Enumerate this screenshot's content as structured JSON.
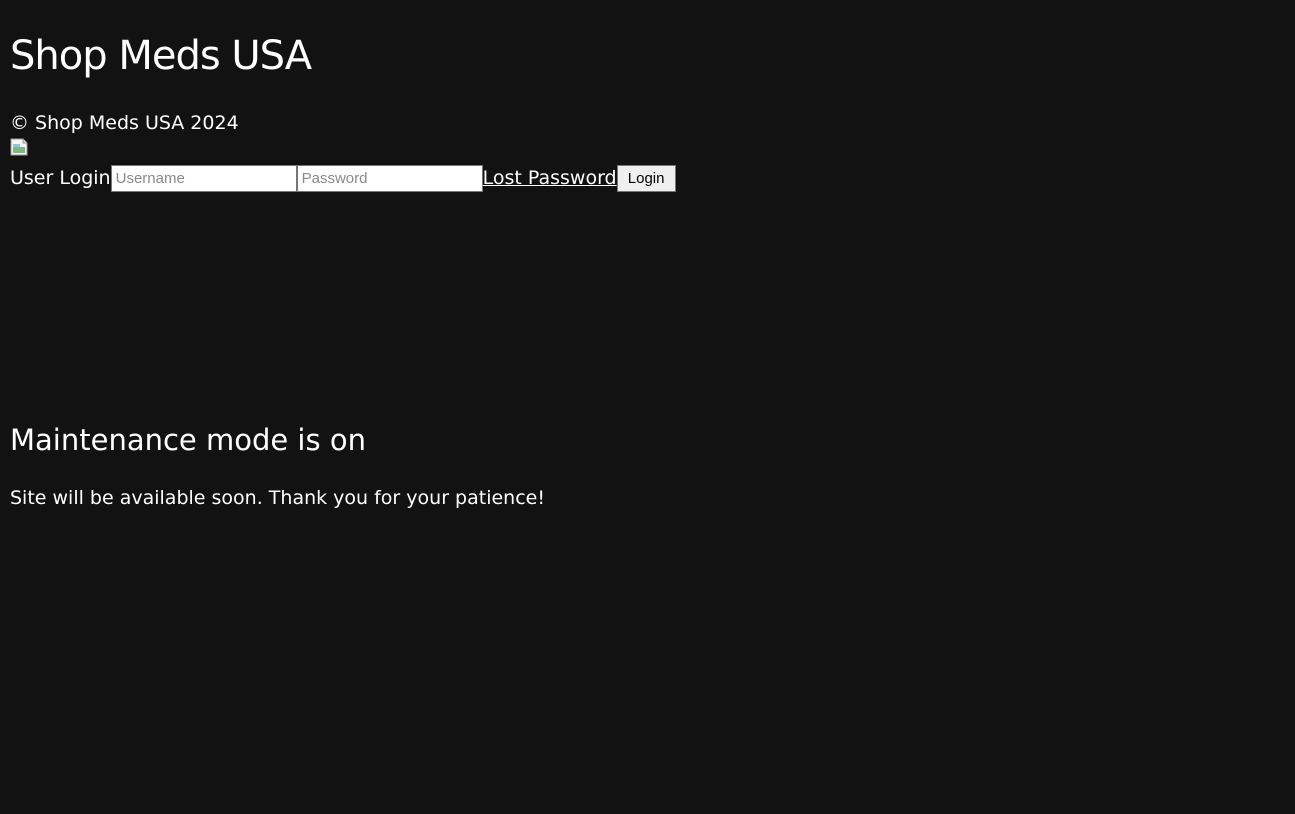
{
  "header": {
    "site_title": "Shop Meds USA",
    "copyright": "© Shop Meds USA 2024",
    "logo_icon": "broken-image-icon"
  },
  "login": {
    "label": "User Login",
    "username_placeholder": "Username",
    "password_placeholder": "Password",
    "lost_password_label": "Lost Password",
    "login_button_label": "Login"
  },
  "maintenance": {
    "heading": "Maintenance mode is on",
    "message": "Site will be available soon. Thank you for your patience!"
  },
  "colors": {
    "background": "#121212",
    "text": "#ffffff"
  }
}
